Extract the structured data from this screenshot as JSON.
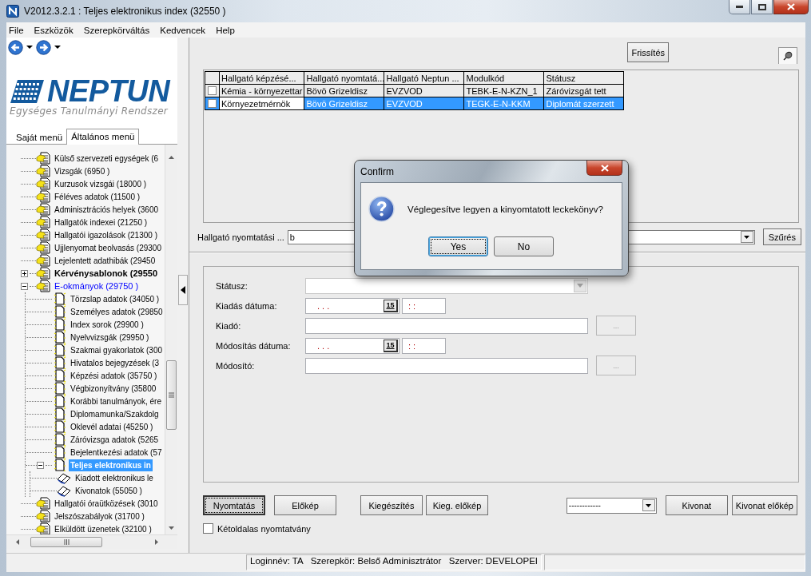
{
  "window": {
    "title": "V2012.3.2.1 : Teljes elektronikus index (32550  )"
  },
  "menu": [
    "File",
    "Eszközök",
    "Szerepkörváltás",
    "Kedvencek",
    "Help"
  ],
  "logo": {
    "name": "NEPTUN",
    "subtitle": "Egységes Tanulmányi Rendszer"
  },
  "sidebar": {
    "tabs": [
      {
        "label": "Saját menü",
        "selected": false
      },
      {
        "label": "Általános menü",
        "selected": true
      }
    ],
    "tree": [
      {
        "label": "Külső szervezeti egységek (6",
        "kind": "module",
        "selected": false
      },
      {
        "label": "Vizsgák (6950  )",
        "kind": "module",
        "selected": false
      },
      {
        "label": "Kurzusok vizsgái (18000  )",
        "kind": "module",
        "selected": false
      },
      {
        "label": "Féléves adatok (11500  )",
        "kind": "module",
        "selected": false
      },
      {
        "label": "Adminisztrációs helyek (3600",
        "kind": "module",
        "selected": false
      },
      {
        "label": "Hallgatók indexei (21250  )",
        "kind": "module",
        "selected": false
      },
      {
        "label": "Hallgatói igazolások (21300  )",
        "kind": "module",
        "selected": false
      },
      {
        "label": "Ujjlenyomat beolvasás (29300",
        "kind": "module",
        "selected": false
      },
      {
        "label": "Lejelentett adathibák (29450",
        "kind": "module",
        "selected": false
      },
      {
        "label": "Kérvénysablonok (29550",
        "kind": "module",
        "selected": false,
        "bold": true,
        "expanded": false
      },
      {
        "label": "E-okmányok (29750  )",
        "kind": "module",
        "selected": false,
        "color": "#0000ff",
        "expanded": true,
        "children": [
          {
            "label": "Törzslap adatok (34050  )",
            "kind": "page",
            "selected": false
          },
          {
            "label": "Személyes adatok (29850",
            "kind": "page",
            "selected": false
          },
          {
            "label": "Index sorok (29900  )",
            "kind": "page",
            "selected": false
          },
          {
            "label": "Nyelvvizsgák (29950  )",
            "kind": "page",
            "selected": false
          },
          {
            "label": "Szakmai gyakorlatok (300",
            "kind": "page",
            "selected": false
          },
          {
            "label": "Hivatalos bejegyzések (3",
            "kind": "page",
            "selected": false
          },
          {
            "label": "Képzési adatok (35750  )",
            "kind": "page",
            "selected": false
          },
          {
            "label": "Végbizonyítvány (35800",
            "kind": "page",
            "selected": false
          },
          {
            "label": "Korábbi tanulmányok, ére",
            "kind": "page",
            "selected": false
          },
          {
            "label": "Diplomamunka/Szakdolg",
            "kind": "page",
            "selected": false
          },
          {
            "label": "Oklevél adatai (45250  )",
            "kind": "page",
            "selected": false
          },
          {
            "label": "Záróvizsga adatok (5265",
            "kind": "page",
            "selected": false
          },
          {
            "label": "Bejelentkezési adatok (57",
            "kind": "page",
            "selected": false
          },
          {
            "label": "Teljes elektronikus in",
            "kind": "page",
            "selected": true,
            "expanded": true,
            "children": [
              {
                "label": "Kiadott elektronikus le",
                "kind": "book",
                "selected": false
              },
              {
                "label": "Kivonatok (55050  )",
                "kind": "book",
                "selected": false
              }
            ]
          }
        ]
      },
      {
        "label": "Hallgatói óraütközések (3010",
        "kind": "module",
        "selected": false
      },
      {
        "label": "Jelszószabályok (31700  )",
        "kind": "module",
        "selected": false
      },
      {
        "label": "Elküldött üzenetek (32100  )",
        "kind": "module",
        "selected": false
      }
    ]
  },
  "toolbar": {
    "refresh_button": "Frissítés"
  },
  "table": {
    "columns": [
      "Hallgató képzésé...",
      "Hallgató nyomtatá...",
      "Hallgató Neptun ...",
      "Modulkód",
      "Státusz"
    ],
    "rows": [
      {
        "checked": false,
        "selected": false,
        "focused": false,
        "cells": [
          "Kémia - környezettar",
          "Bövö Grizeldisz",
          "EVZVOD",
          "TEBK-E-N-KZN_1",
          "Záróvizsgát tett"
        ]
      },
      {
        "checked": false,
        "selected": true,
        "focused": true,
        "cells": [
          "Környezetmérnök",
          "Bövö Grizeldisz",
          "EVZVOD",
          "TEGK-E-N-KKM",
          "Diplomát szerzett"
        ]
      }
    ]
  },
  "filter": {
    "label": "Hallgató nyomtatási ...",
    "value": "b",
    "button": "Szűrés"
  },
  "form": {
    "fields": [
      {
        "kind": "select",
        "label": "Státusz:",
        "disabled": true
      },
      {
        "kind": "datetime",
        "label": "Kiadás dátuma:",
        "date": ". . .",
        "calendar": "15",
        "time": ": :"
      },
      {
        "kind": "lookup",
        "label": "Kiadó:",
        "button": "...",
        "disabled": true
      },
      {
        "kind": "datetime",
        "label": "Módosítás dátuma:",
        "date": ". . .",
        "calendar": "15",
        "time": ": :"
      },
      {
        "kind": "lookup",
        "label": "Módosító:",
        "button": "...",
        "disabled": true
      }
    ]
  },
  "actions": [
    {
      "kind": "button",
      "label": "Nyomtatás",
      "default": true
    },
    {
      "kind": "button",
      "label": "Előkép",
      "default": false
    },
    {
      "kind": "button",
      "label": "Kiegészítés",
      "default": false
    },
    {
      "kind": "button",
      "label": "Kieg. előkép",
      "default": false
    },
    {
      "kind": "combo",
      "label": "------------"
    },
    {
      "kind": "button",
      "label": "Kivonat",
      "default": false
    },
    {
      "kind": "button",
      "label": "Kivonat előkép",
      "default": false
    }
  ],
  "duplex": {
    "label": "Kétoldalas nyomtatvány",
    "checked": false
  },
  "status_bar": {
    "text": "Loginnév: TA   Szerepkör: Belső Adminisztrátor   Szerver: DEVELOPEI"
  },
  "dialog": {
    "title": "Confirm",
    "message": "Véglegesítve legyen a kinyomtatott leckekönyv?",
    "buttons": [
      {
        "label": "Yes",
        "selected": true
      },
      {
        "label": "No",
        "selected": false
      }
    ]
  }
}
